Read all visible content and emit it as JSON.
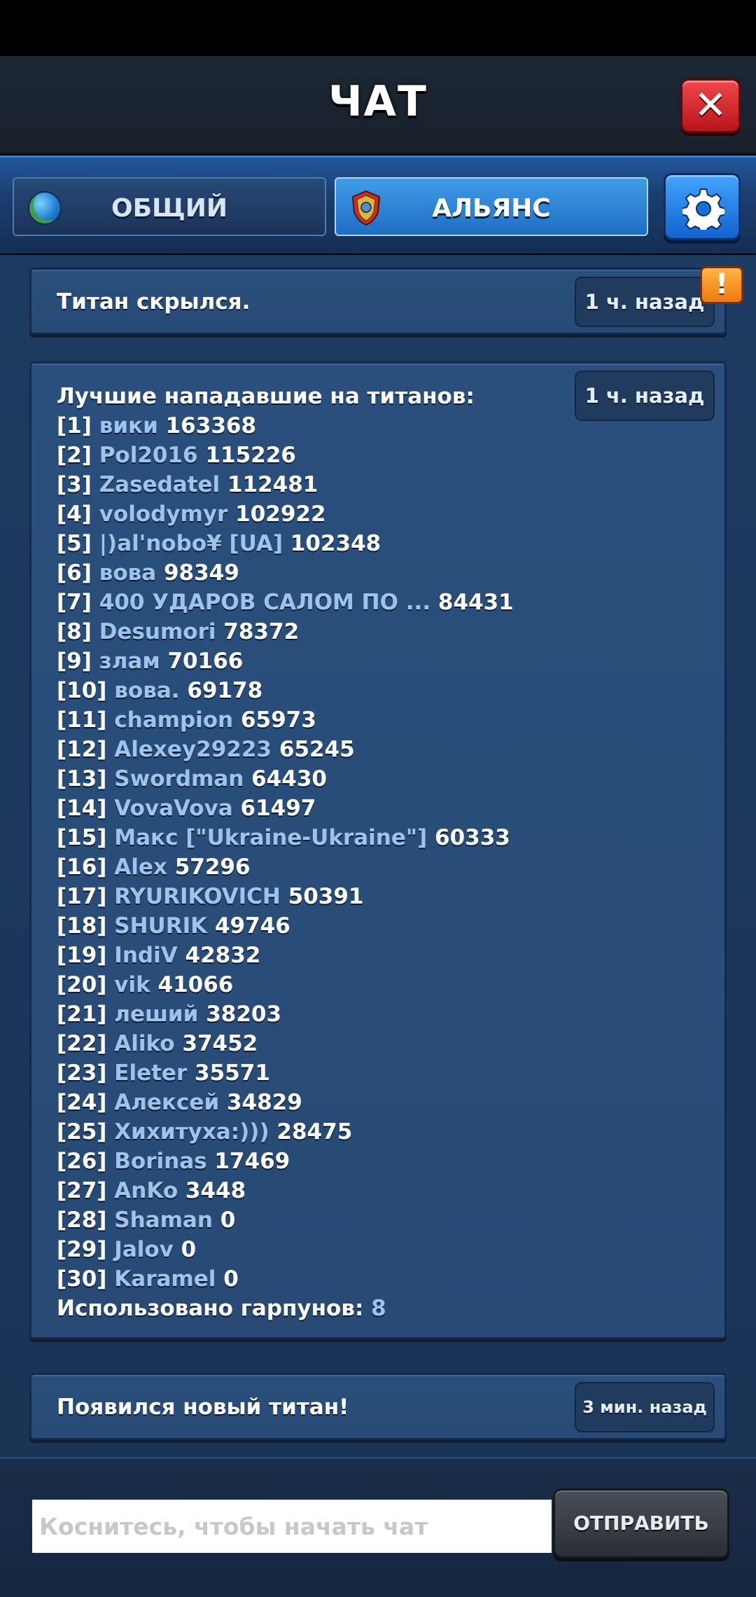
{
  "header": {
    "title": "ЧАТ"
  },
  "tabs": [
    {
      "label": "ОБЩИЙ",
      "icon": "globe-icon",
      "active": false
    },
    {
      "label": "АЛЬЯНС",
      "icon": "alliance-shield-icon",
      "active": true
    }
  ],
  "messages": [
    {
      "text": "Титан скрылся.",
      "time": "1 ч. назад"
    },
    {
      "title": "Лучшие нападавшие на титанов:",
      "time": "1 ч. назад",
      "rows": [
        {
          "rank": "[1]",
          "name": "вики",
          "score": "163368"
        },
        {
          "rank": "[2]",
          "name": "Pol2016",
          "score": "115226"
        },
        {
          "rank": "[3]",
          "name": "Zasedatel",
          "score": "112481"
        },
        {
          "rank": "[4]",
          "name": "volodymyr",
          "score": "102922"
        },
        {
          "rank": "[5]",
          "name": "|)al'nobo¥ [UA]",
          "score": "102348"
        },
        {
          "rank": "[6]",
          "name": "вова",
          "score": "98349"
        },
        {
          "rank": "[7]",
          "name": "400 УДАРОВ САЛОМ ПО ...",
          "score": "84431"
        },
        {
          "rank": "[8]",
          "name": "Desumori",
          "score": "78372"
        },
        {
          "rank": "[9]",
          "name": "злам",
          "score": "70166"
        },
        {
          "rank": "[10]",
          "name": "вова.",
          "score": "69178"
        },
        {
          "rank": "[11]",
          "name": "champion",
          "score": "65973"
        },
        {
          "rank": "[12]",
          "name": "Alexey29223",
          "score": "65245"
        },
        {
          "rank": "[13]",
          "name": "Swordman",
          "score": "64430"
        },
        {
          "rank": "[14]",
          "name": "VovaVova",
          "score": "61497"
        },
        {
          "rank": "[15]",
          "name": "Макс [\"Ukraine-Ukraine\"]",
          "score": "60333"
        },
        {
          "rank": "[16]",
          "name": "Alex",
          "score": "57296"
        },
        {
          "rank": "[17]",
          "name": "RYURIKOVICH",
          "score": "50391"
        },
        {
          "rank": "[18]",
          "name": "SHURIK",
          "score": "49746"
        },
        {
          "rank": "[19]",
          "name": "IndiV",
          "score": "42832"
        },
        {
          "rank": "[20]",
          "name": "vik",
          "score": "41066"
        },
        {
          "rank": "[21]",
          "name": "леший",
          "score": "38203"
        },
        {
          "rank": "[22]",
          "name": "Aliko",
          "score": "37452"
        },
        {
          "rank": "[23]",
          "name": "Eleter",
          "score": "35571"
        },
        {
          "rank": "[24]",
          "name": "Алексей",
          "score": "34829"
        },
        {
          "rank": "[25]",
          "name": "Хихитуха:)))",
          "score": "28475"
        },
        {
          "rank": "[26]",
          "name": "Borinas",
          "score": "17469"
        },
        {
          "rank": "[27]",
          "name": "AnKo",
          "score": "3448"
        },
        {
          "rank": "[28]",
          "name": "Shaman",
          "score": "0"
        },
        {
          "rank": "[29]",
          "name": "Jalov",
          "score": "0"
        },
        {
          "rank": "[30]",
          "name": "Karamel",
          "score": "0"
        }
      ],
      "footer_label": "Использовано гарпунов:",
      "footer_value": "8"
    },
    {
      "text": "Появился новый титан!",
      "time": "3 мин. назад"
    }
  ],
  "input": {
    "placeholder": "Коснитесь, чтобы начать чат",
    "value": ""
  },
  "send_label": "ОТПРАВИТЬ",
  "warning_icon": "!"
}
